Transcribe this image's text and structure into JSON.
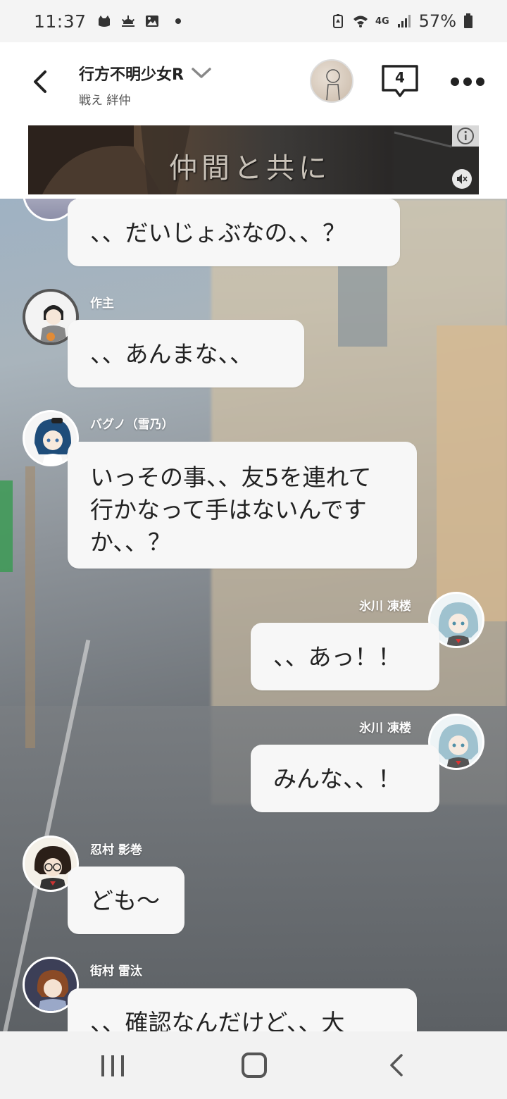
{
  "status_bar": {
    "time": "11:37",
    "battery": "57%",
    "network": "4G"
  },
  "header": {
    "title": "行方不明少女R",
    "subtitle": "戦え 絆仲",
    "comment_count": "4"
  },
  "ad": {
    "text": "仲間と共に"
  },
  "messages": [
    {
      "side": "left",
      "name": "",
      "text": "、、だいじょぶなの、、？"
    },
    {
      "side": "left",
      "name": "作主",
      "text": "、、あんまな、、"
    },
    {
      "side": "left",
      "name": "バグノ（雪乃）",
      "text": "いっその事、、友5を連れて行かなって手はないんですか、、？"
    },
    {
      "side": "right",
      "name": "氷川 凍楼",
      "text": "、、あっ！！"
    },
    {
      "side": "right",
      "name": "氷川 凍楼",
      "text": "みんな、、！"
    },
    {
      "side": "left",
      "name": "忍村 影巻",
      "text": "ども〜"
    },
    {
      "side": "left",
      "name": "街村 雷汰",
      "text": "、、確認なんだけど、、大"
    }
  ],
  "colors": {
    "bubble": "#f7f7f7",
    "header_bg": "#ffffff",
    "status_bg": "#f4f4f4",
    "nav_bg": "#f2f2f2"
  },
  "icons": {
    "back": "back-arrow-icon",
    "chevron": "chevron-down-icon",
    "comments": "comment-bubble-icon",
    "more": "more-icon",
    "info": "info-icon",
    "mute": "mute-icon"
  }
}
